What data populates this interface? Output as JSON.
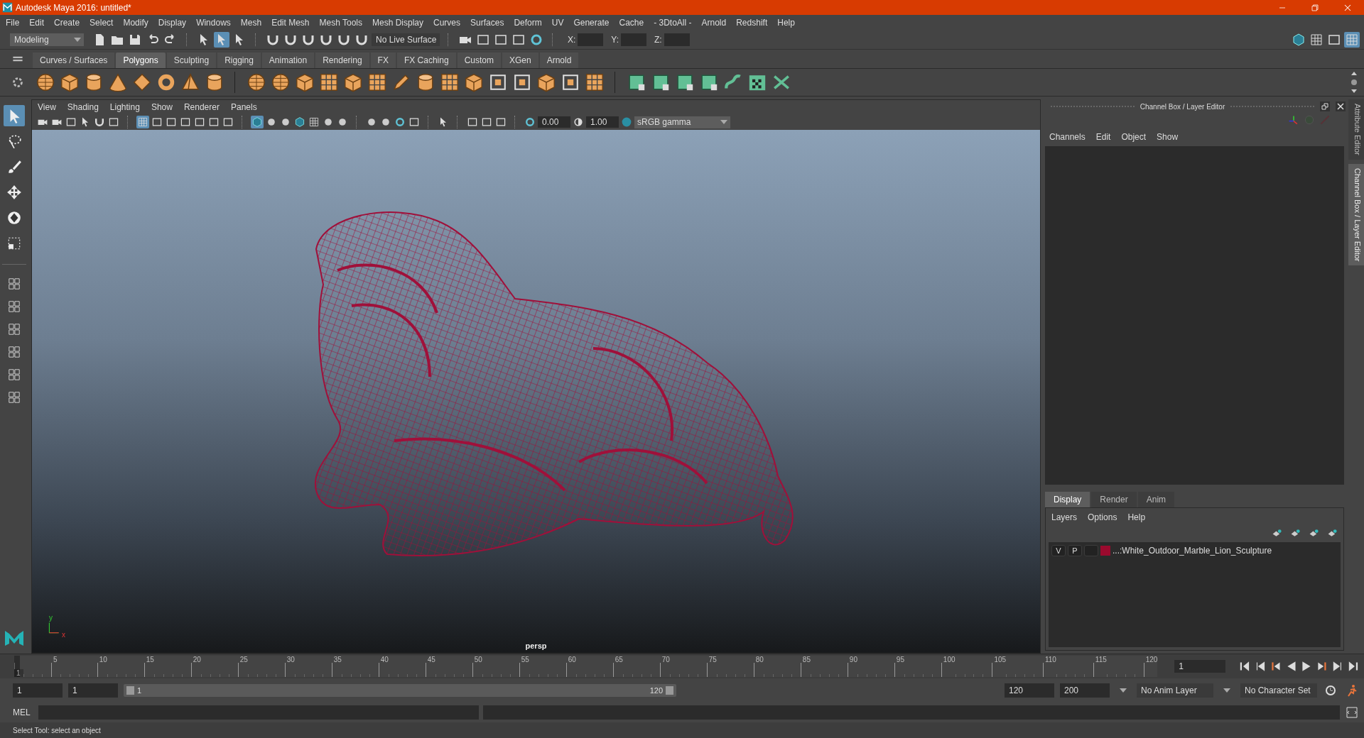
{
  "window": {
    "title": "Autodesk Maya 2016: untitled*"
  },
  "menu_bar": [
    "File",
    "Edit",
    "Create",
    "Select",
    "Modify",
    "Display",
    "Windows",
    "Mesh",
    "Edit Mesh",
    "Mesh Tools",
    "Mesh Display",
    "Curves",
    "Surfaces",
    "Deform",
    "UV",
    "Generate",
    "Cache",
    "- 3DtoAll -",
    "Arnold",
    "Redshift",
    "Help"
  ],
  "status_line": {
    "mode": "Modeling",
    "live_surface": "No Live Surface",
    "coords": [
      "X:",
      "Y:",
      "Z:"
    ]
  },
  "shelf_tabs": [
    {
      "label": "Curves / Surfaces",
      "selected": false
    },
    {
      "label": "Polygons",
      "selected": true
    },
    {
      "label": "Sculpting",
      "selected": false
    },
    {
      "label": "Rigging",
      "selected": false
    },
    {
      "label": "Animation",
      "selected": false
    },
    {
      "label": "Rendering",
      "selected": false
    },
    {
      "label": "FX",
      "selected": false
    },
    {
      "label": "FX Caching",
      "selected": false
    },
    {
      "label": "Custom",
      "selected": false
    },
    {
      "label": "XGen",
      "selected": false
    },
    {
      "label": "Arnold",
      "selected": false
    }
  ],
  "toolbox": [
    {
      "selected": true
    },
    {
      "selected": false
    },
    {
      "selected": false
    },
    {
      "selected": false
    },
    {
      "selected": false
    },
    {
      "selected": false
    }
  ],
  "viewport": {
    "menus": [
      "View",
      "Shading",
      "Lighting",
      "Show",
      "Renderer",
      "Panels"
    ],
    "exposure": "0.00",
    "gamma": "1.00",
    "color_space": "sRGB gamma",
    "camera_label": "persp",
    "axes": [
      "y",
      "x"
    ]
  },
  "channel_box": {
    "title": "Channel Box / Layer Editor",
    "menus": [
      "Channels",
      "Edit",
      "Object",
      "Show"
    ]
  },
  "layer_editor": {
    "tabs": [
      {
        "label": "Display",
        "selected": true
      },
      {
        "label": "Render",
        "selected": false
      },
      {
        "label": "Anim",
        "selected": false
      }
    ],
    "menus": [
      "Layers",
      "Options",
      "Help"
    ],
    "layers": [
      {
        "visible": "V",
        "playback": "P",
        "color": "#9b0a2e",
        "name": "...:White_Outdoor_Marble_Lion_Sculpture"
      }
    ]
  },
  "side_tabs": [
    {
      "label": "Attribute Editor",
      "selected": false
    },
    {
      "label": "Channel Box / Layer Editor",
      "selected": true
    }
  ],
  "timeline": {
    "labels": [
      "1",
      "5",
      "10",
      "15",
      "20",
      "25",
      "30",
      "35",
      "40",
      "45",
      "50",
      "55",
      "60",
      "65",
      "70",
      "75",
      "80",
      "85",
      "90",
      "95",
      "100",
      "105",
      "110",
      "115",
      "120"
    ],
    "current_frame": "1",
    "level": 0
  },
  "range": {
    "start": "1",
    "playback_start": "1",
    "level": 1,
    "slider_start": "1",
    "slider_end": "120",
    "playback_end": "120",
    "end": "200",
    "anim_layer": "No Anim Layer",
    "character_set": "No Character Set"
  },
  "command_line": {
    "label": "MEL"
  },
  "help_line": "Select Tool: select an object"
}
